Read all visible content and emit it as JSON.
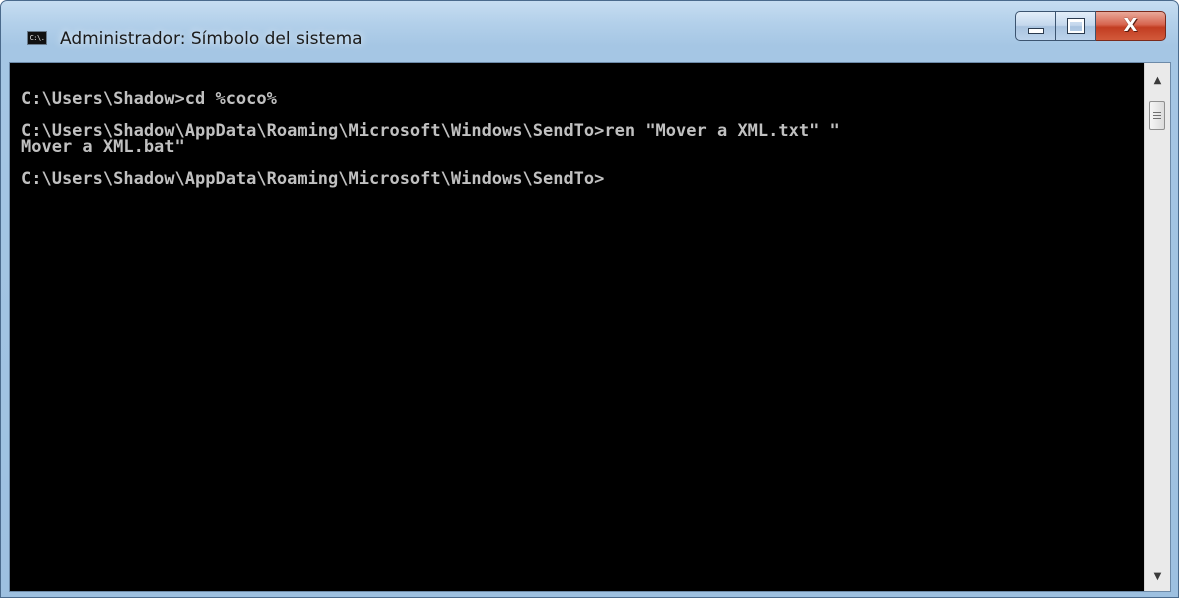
{
  "window": {
    "title": "Administrador: Símbolo del sistema",
    "icon": "cmd-app-icon",
    "icon_text": "C:\\."
  },
  "caption_buttons": {
    "minimize": "minimize-icon",
    "maximize": "maximize-icon",
    "close": "close-icon",
    "close_glyph": "X"
  },
  "console": {
    "background": "#000000",
    "foreground": "#c0c0c0",
    "lines": [
      "C:\\Users\\Shadow>cd %coco%",
      "",
      "C:\\Users\\Shadow\\AppData\\Roaming\\Microsoft\\Windows\\SendTo>ren \"Mover a XML.txt\" \"",
      "Mover a XML.bat\"",
      "",
      "C:\\Users\\Shadow\\AppData\\Roaming\\Microsoft\\Windows\\SendTo>"
    ]
  },
  "scrollbar": {
    "up_icon": "scroll-up-arrow-icon",
    "down_icon": "scroll-down-arrow-icon",
    "up_glyph": "▲",
    "down_glyph": "▼",
    "position_fraction": 0.0
  }
}
